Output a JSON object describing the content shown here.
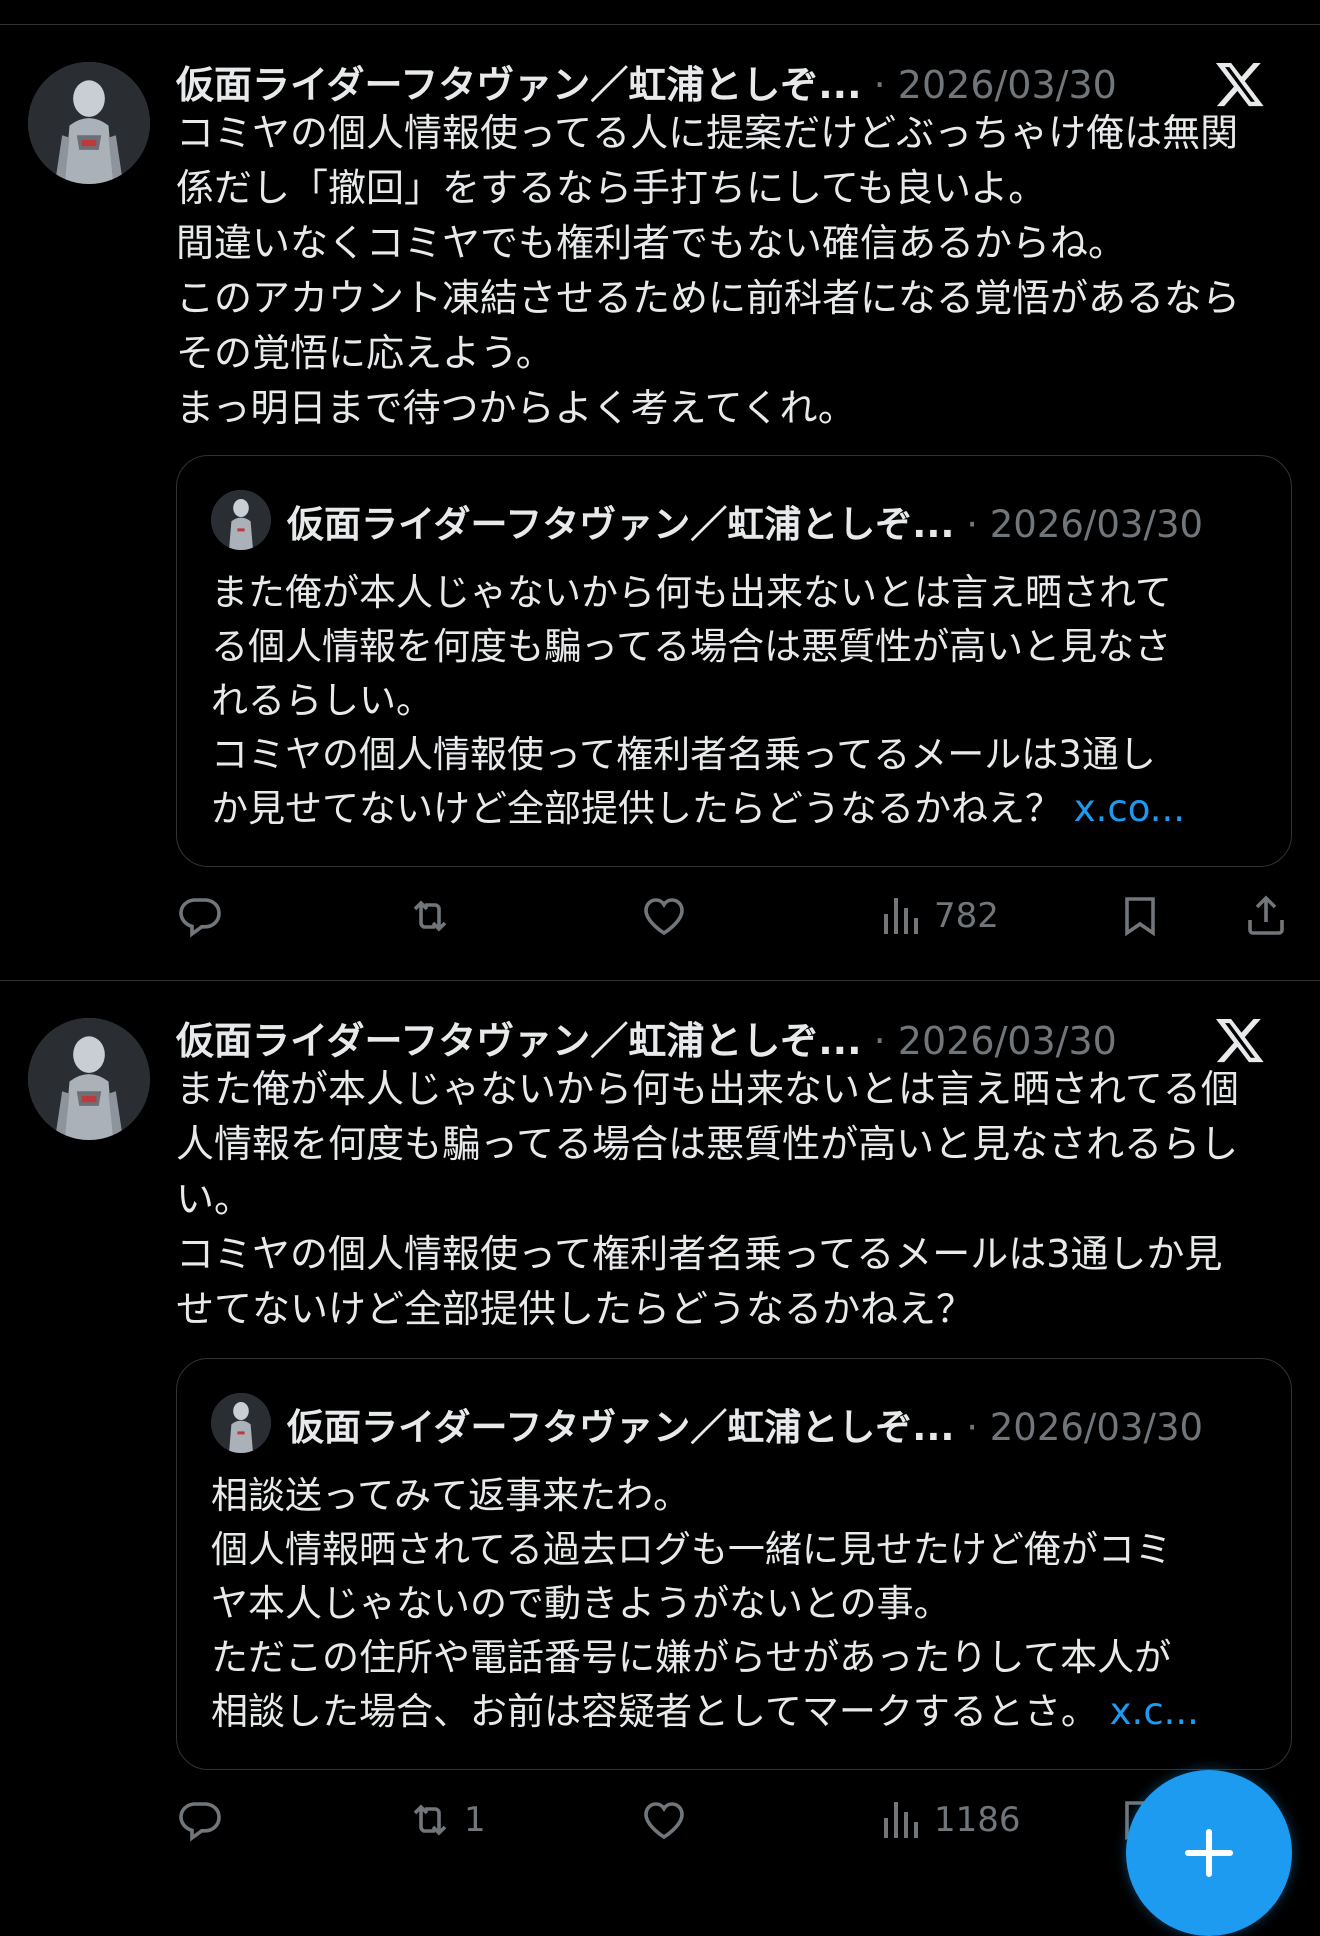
{
  "tweets": [
    {
      "author": "仮面ライダーフタヴァン／虹浦としぞ...",
      "dot": "·",
      "date": "2026/03/30",
      "text": "コミヤの個人情報使ってる人に提案だけどぶっちゃけ俺は無関\n係だし「撤回」をするなら手打ちにしても良いよ。\n間違いなくコミヤでも権利者でもない確信あるからね。\nこのアカウント凍結させるために前科者になる覚悟があるなら\nその覚悟に応えよう。\nまっ明日まで待つからよく考えてくれ。",
      "quote": {
        "author": "仮面ライダーフタヴァン／虹浦としぞ...",
        "dot": "·",
        "date": "2026/03/30",
        "text": "また俺が本人じゃないから何も出来ないとは言え晒されて\nる個人情報を何度も騙ってる場合は悪質性が高いと見なさ\nれるらしい。\nコミヤの個人情報使って権利者名乗ってるメールは3通し\nか見せてないけど全部提供したらどうなるかねえ？ ",
        "link": "x.co..."
      },
      "stats": {
        "replies": "",
        "retweets": "",
        "likes": "",
        "views": "782"
      }
    },
    {
      "author": "仮面ライダーフタヴァン／虹浦としぞ...",
      "dot": "·",
      "date": "2026/03/30",
      "text": "また俺が本人じゃないから何も出来ないとは言え晒されてる個\n人情報を何度も騙ってる場合は悪質性が高いと見なされるらし\nい。\nコミヤの個人情報使って権利者名乗ってるメールは3通しか見\nせてないけど全部提供したらどうなるかねえ？",
      "quote": {
        "author": "仮面ライダーフタヴァン／虹浦としぞ...",
        "dot": "·",
        "date": "2026/03/30",
        "text": "相談送ってみて返事来たわ。\n個人情報晒されてる過去ログも一緒に見せたけど俺がコミ\nヤ本人じゃないので動きようがないとの事。\nただこの住所や電話番号に嫌がらせがあったりして本人が\n相談した場合、お前は容疑者としてマークするとさ。 ",
        "link": "x.c..."
      },
      "stats": {
        "replies": "",
        "retweets": "1",
        "likes": "",
        "views": "1186"
      }
    }
  ],
  "icons": {
    "reply": "reply-icon",
    "retweet": "retweet-icon",
    "like": "heart-icon",
    "views": "views-chart-icon",
    "bookmark": "bookmark-icon",
    "share": "share-icon",
    "x_logo": "x-logo-icon",
    "compose": "plus-icon"
  },
  "colors": {
    "background": "#000000",
    "text": "#e7e9ea",
    "muted": "#71767b",
    "link": "#1d9bf0",
    "border": "#2f3336",
    "accent": "#1d9bf0"
  }
}
